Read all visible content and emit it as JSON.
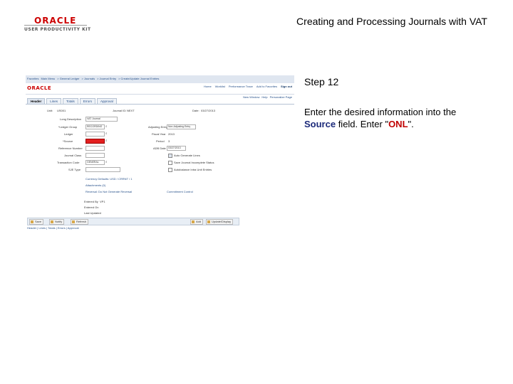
{
  "header": {
    "logo_oracle": "ORACLE",
    "logo_upk": "USER PRODUCTIVITY KIT",
    "doc_title": "Creating and Processing Journals with VAT"
  },
  "step": {
    "label": "Step 12",
    "instruction_pre": "Enter the desired information into the ",
    "field_name": "Source",
    "instruction_mid": " field. Enter \"",
    "entry_value": "ONL",
    "instruction_post": "\"."
  },
  "screenshot": {
    "brand": "ORACLE",
    "breadcrumbs": [
      "Favorites",
      "Main Menu",
      "> General Ledger",
      "> Journals",
      "> Journal Entry",
      "> Create/Update Journal Entries"
    ],
    "top_links": [
      {
        "label": "Home",
        "bold": false
      },
      {
        "label": "Worklist",
        "bold": false
      },
      {
        "label": "Performance Trace",
        "bold": false
      },
      {
        "label": "Add to Favorites",
        "bold": false
      },
      {
        "label": "Sign out",
        "bold": true
      }
    ],
    "sub_links": [
      "New Window",
      "Help",
      "Personalize Page"
    ],
    "tabs": [
      {
        "label": "Header",
        "active": true
      },
      {
        "label": "Lines",
        "active": false
      },
      {
        "label": "Totals",
        "active": false
      },
      {
        "label": "Errors",
        "active": false
      },
      {
        "label": "Approval",
        "active": false
      }
    ],
    "unit_label": "Unit:",
    "unit_value": "US001",
    "journal_id_label": "Journal ID:",
    "journal_id_value": "NEXT",
    "date_label": "Date:",
    "date_value": "03/27/2013",
    "long_desc_label": "Long Description",
    "long_desc_value": "VAT Journal",
    "ledger_group_label": "*Ledger Group",
    "ledger_group_value": "RECORDING",
    "adb_label": "Adjusting Entry:",
    "adb_value": "Non-Adjusting Entry",
    "ledger_label": "Ledger",
    "fiscal_year_label": "Fiscal Year",
    "fiscal_year_value": "2013",
    "source_label": "*Source",
    "period_label": "Period",
    "period_value": "3",
    "reference_label": "Reference Number",
    "adb_date_label": "ADB Date",
    "adb_date_value": "03/27/2013",
    "journal_class_label": "Journal Class",
    "auto_generate_label": "Auto Generate Lines",
    "trans_code_label": "Transaction Code",
    "trans_code_value": "GENERAL",
    "save_suspended_label": "Save Journal Incomplete Status",
    "sj_type_label": "SJE Type",
    "autobalance_label": "Autobalance Intra Unit Entries",
    "reversal_link": "Currency Defaults: USD / CRRNT / 1",
    "attachments_link": "Attachments (0)",
    "reversal_text": "Reversal: Do Not Generate Reversal",
    "commitment_link": "Commitment Control",
    "entered_by_label": "Entered By",
    "entered_by_value": "VP1",
    "entered_on_label": "Entered On",
    "last_updated_label": "Last Updated",
    "buttons_left": [
      "Save",
      "Notify",
      "Refresh"
    ],
    "buttons_right": [
      "Add",
      "Update/Display"
    ],
    "footer_links": "Header | Lines | Totals | Errors | Approval"
  }
}
